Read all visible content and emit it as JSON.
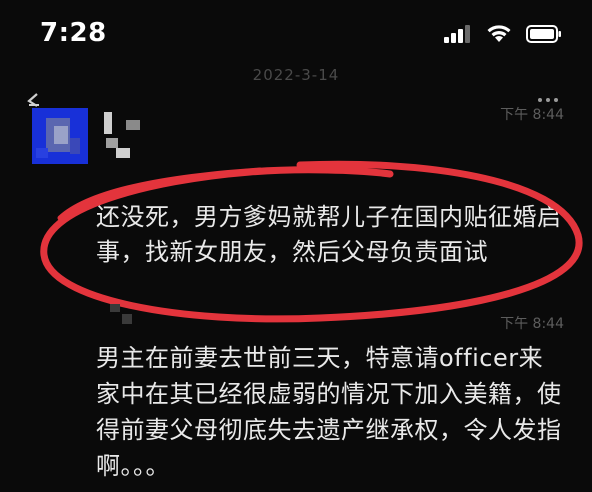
{
  "status_bar": {
    "time": "7:28"
  },
  "chat": {
    "date": "2022-3-14",
    "messages": [
      {
        "time": "下午 8:44",
        "text": "还没死，男方爹妈就帮儿子在国内贴征婚启事，找新女朋友，然后父母负责面试",
        "highlighted": true
      },
      {
        "time": "下午 8:44",
        "text": "男主在前妻去世前三天，特意请officer来家中在其已经很虚弱的情况下加入美籍，使得前妻父母彻底失去遗产继承权，令人发指啊。。。",
        "highlighted": false
      }
    ]
  },
  "icons": {
    "signal": "cellular-signal-icon",
    "wifi": "wifi-icon",
    "battery": "battery-icon",
    "back": "back-arrow-icon",
    "more": "more-dots-icon"
  },
  "colors": {
    "background": "#0a0a0a",
    "text": "#e9e9e9",
    "timestamp": "#5d5d5d",
    "annotation": "#e3343c",
    "avatar": "#1830d8"
  }
}
